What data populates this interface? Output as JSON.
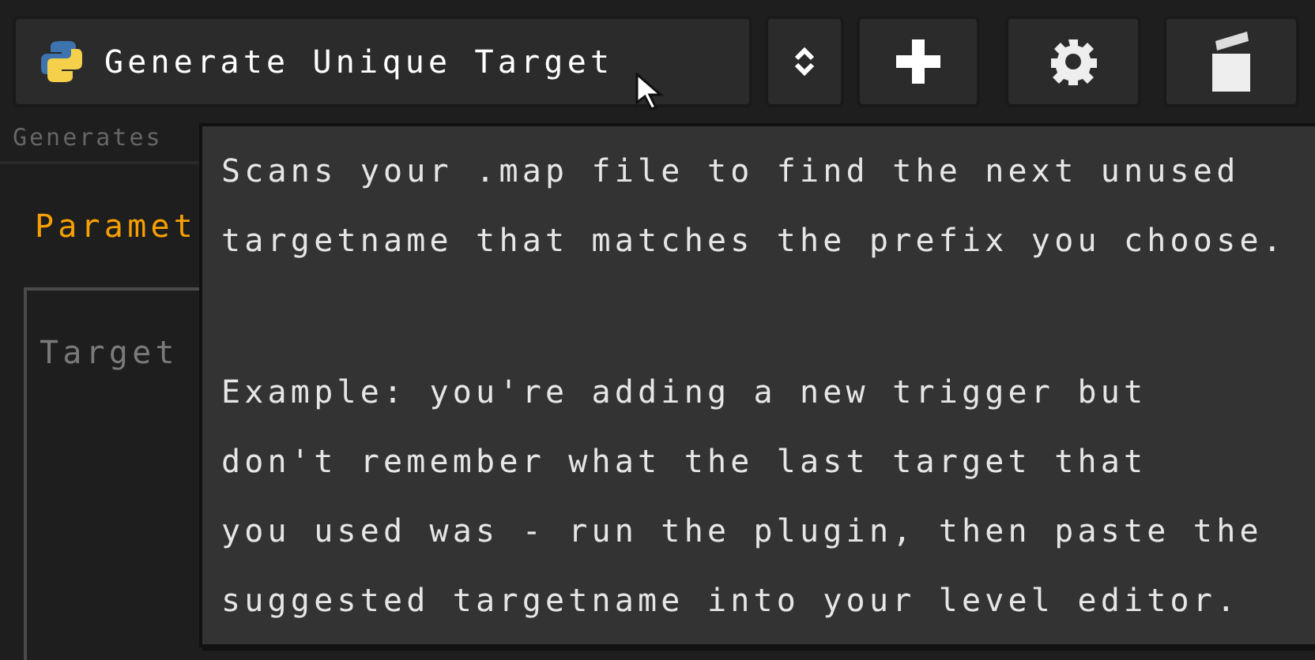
{
  "plugin_selector": {
    "label": "Generate Unique Target"
  },
  "description": "Generates",
  "section_title": "Paramet",
  "group": {
    "field_label": "Target"
  },
  "tooltip": {
    "paragraphs": [
      [
        "Scans your .map file to find the next unused",
        "targetname that matches the prefix you choose."
      ],
      [
        "Example: you're adding a new trigger but",
        "don't remember what the last target that",
        "you used was - run the plugin, then paste the",
        "suggested targetname into your level editor."
      ]
    ]
  }
}
